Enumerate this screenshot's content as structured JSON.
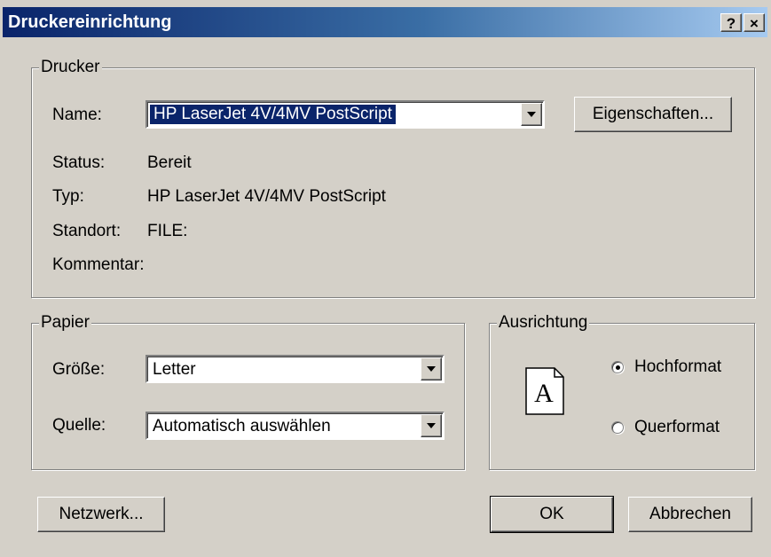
{
  "window": {
    "title": "Druckereinrichtung",
    "help_glyph": "?",
    "close_glyph": "×"
  },
  "drucker": {
    "group_label": "Drucker",
    "name_label": "Name:",
    "name_value": "HP LaserJet 4V/4MV PostScript",
    "properties_button": "Eigenschaften...",
    "status_label": "Status:",
    "status_value": "Bereit",
    "typ_label": "Typ:",
    "typ_value": "HP LaserJet 4V/4MV PostScript",
    "standort_label": "Standort:",
    "standort_value": "FILE:",
    "kommentar_label": "Kommentar:",
    "kommentar_value": ""
  },
  "papier": {
    "group_label": "Papier",
    "groesse_label": "Größe:",
    "groesse_value": "Letter",
    "quelle_label": "Quelle:",
    "quelle_value": "Automatisch auswählen"
  },
  "ausrichtung": {
    "group_label": "Ausrichtung",
    "page_glyph": "A",
    "hochformat_label": "Hochformat",
    "hochformat_selected": true,
    "querformat_label": "Querformat",
    "querformat_selected": false
  },
  "buttons": {
    "netzwerk": "Netzwerk...",
    "ok": "OK",
    "abbrechen": "Abbrechen"
  },
  "colors": {
    "titlebar_start": "#0a246a",
    "titlebar_end": "#a6caf0",
    "face": "#d4d0c8",
    "selection": "#0a246a"
  },
  "icons": [
    "help-icon",
    "close-icon",
    "dropdown-arrow-icon",
    "portrait-page-icon",
    "radio-button-icon"
  ]
}
